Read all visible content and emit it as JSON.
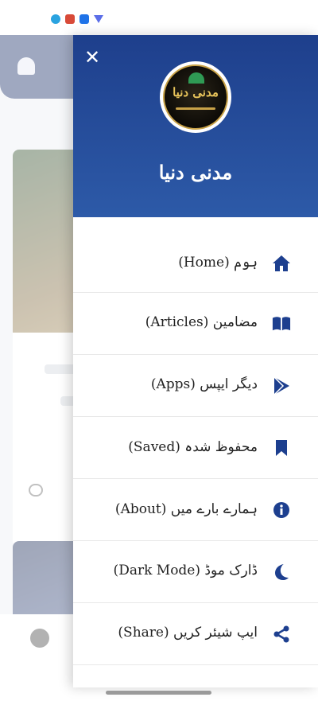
{
  "status_bar": {
    "icons": [
      "telegram-icon",
      "gmail-icon",
      "key-icon",
      "vpn-icon"
    ]
  },
  "drawer": {
    "close_label": "✕",
    "app_name": "مدنی دنیا",
    "logo_text": "مدنی دنیا",
    "header_color": "#1e3f8c",
    "icon_color": "#1d3f8f",
    "items": [
      {
        "label": "ہوم (Home)",
        "icon": "home-icon"
      },
      {
        "label": "مضامین (Articles)",
        "icon": "book-icon"
      },
      {
        "label": "دیگر ایپس (Apps)",
        "icon": "play-store-icon"
      },
      {
        "label": "محفوظ شدہ (Saved)",
        "icon": "bookmark-icon"
      },
      {
        "label": "ہمارے بارے میں (About)",
        "icon": "info-icon"
      },
      {
        "label": "ڈارک موڈ (Dark Mode)",
        "icon": "moon-icon"
      },
      {
        "label": "ایپ شیئر کریں (Share)",
        "icon": "share-icon"
      }
    ]
  }
}
